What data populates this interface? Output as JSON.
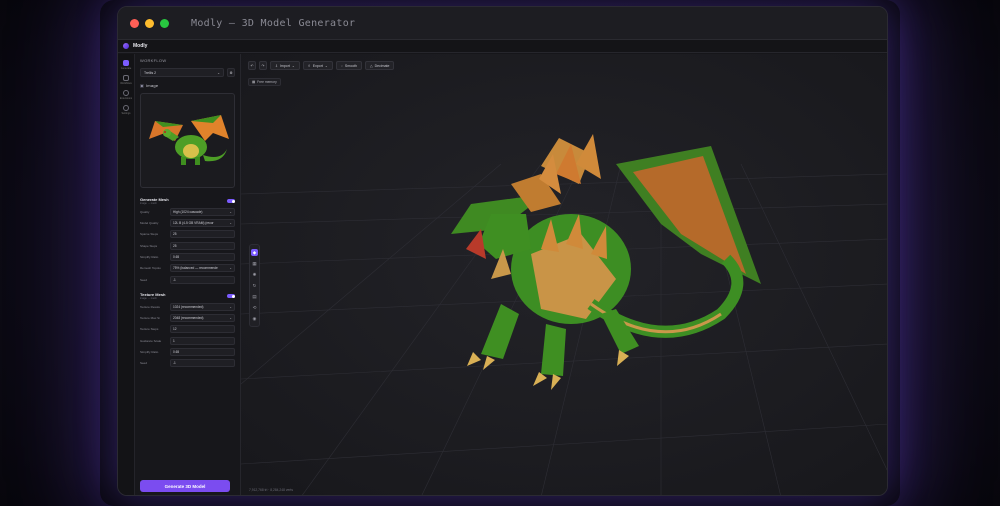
{
  "window": {
    "title": "Modly — 3D Model Generator"
  },
  "app": {
    "name": "Modly"
  },
  "rail": [
    {
      "label": "Generate",
      "active": true
    },
    {
      "label": "Workflows",
      "active": false
    },
    {
      "label": "Extensions",
      "active": false
    },
    {
      "label": "Settings",
      "active": false
    }
  ],
  "panel": {
    "workflow_label": "WORKFLOW",
    "workflow_value": "Trellis 2",
    "image_label": "Image",
    "generate_mesh": {
      "title": "Generate Mesh",
      "subtitle": "image → mesh",
      "enabled": true,
      "rows": [
        {
          "key": "Quality",
          "value": "High (1024 cascade)",
          "dropdown": true
        },
        {
          "key": "Model Quality",
          "value": "12L B (4-5 GB VRAM) (recor",
          "dropdown": true
        },
        {
          "key": "Sparse Steps",
          "value": "25",
          "dropdown": false
        },
        {
          "key": "Shape Steps",
          "value": "25",
          "dropdown": false
        },
        {
          "key": "Simplify Ratio",
          "value": "0.65",
          "dropdown": false
        },
        {
          "key": "Remesh Topolo",
          "value": "75% (balanced — recommende",
          "dropdown": true
        },
        {
          "key": "Seed",
          "value": "-1",
          "dropdown": false
        }
      ]
    },
    "texture_mesh": {
      "title": "Texture Mesh",
      "subtitle": "image → mesh",
      "enabled": true,
      "rows": [
        {
          "key": "Texture Resolu",
          "value": "1024 (recommended)",
          "dropdown": true
        },
        {
          "key": "Texture Max Si",
          "value": "2048 (recommended)",
          "dropdown": true
        },
        {
          "key": "Texture Steps",
          "value": "12",
          "dropdown": false
        },
        {
          "key": "Guidance Scale",
          "value": "1",
          "dropdown": false
        },
        {
          "key": "Simplify Ratio",
          "value": "0.65",
          "dropdown": false
        },
        {
          "key": "Seed",
          "value": "-1",
          "dropdown": false
        }
      ]
    },
    "generate_button": "Generate 3D Model"
  },
  "toolbar": {
    "import_label": "Import",
    "export_label": "Export",
    "smooth_label": "Smooth",
    "decimate_label": "Decimate"
  },
  "viewport": {
    "free_memory_label": "Free memory",
    "status": "7,912,768 tri · 8,284,248 verts"
  },
  "colors": {
    "accent": "#7b5cff",
    "button": "#7b4cf0"
  }
}
